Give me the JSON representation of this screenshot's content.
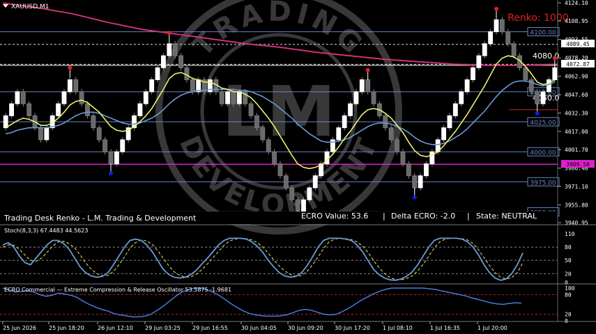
{
  "header": {
    "symbol_label": "XAUUSD,M1",
    "renko_label": "Renko: 1000",
    "status_line": {
      "title": "Trading Desk Renko - L.M. Trading & Development",
      "ecro_value": "ECRO Value: 53.6",
      "delta_ecro": "Delta ECRO: -2.0",
      "state": "State: NEUTRAL",
      "separator": "|"
    }
  },
  "watermark": {
    "top_text": "TRADING",
    "bottom_text": "DEVELOPMENT",
    "center_text": "LM"
  },
  "price_axis": {
    "ticks": [
      "4124.10",
      "4108.95",
      "4093.55",
      "4078.20",
      "4062.90",
      "4047.60",
      "4032.30",
      "4017.00",
      "4001.70",
      "3986.40",
      "3971.10",
      "3955.80",
      "3940.95"
    ],
    "tags": {
      "current_price": "4072.87",
      "line_4089": "4089.45",
      "line_3989": "3989.58"
    }
  },
  "levels": {
    "labels": [
      "4100.00",
      "4050.00",
      "4025.00",
      "4000.00",
      "3975.00",
      "3950.00"
    ],
    "inline_labels": [
      "4080.0",
      "4050.0"
    ]
  },
  "stoch": {
    "label": "Stoch(8,3,3) 67.4483 44.5623",
    "axis_ticks": [
      "110",
      "80",
      "50",
      "20",
      "0"
    ]
  },
  "ecro": {
    "label": "ECRO Commercial — Extreme Compression & Release Oscillator 53.5875 -1.9681",
    "axis_ticks": [
      "100",
      "80",
      "20",
      "0"
    ]
  },
  "time_axis": {
    "labels": [
      "25 Jun 2026",
      "25 Jun 18:20",
      "26 Jun 12:10",
      "29 Jun 03:25",
      "29 Jun 16:55",
      "30 Jun 04:05",
      "30 Jun 09:20",
      "30 Jun 17:20",
      "1 Jul 08:10",
      "1 Jul 16:35",
      "1 Jul 20:00"
    ]
  },
  "chart_data": {
    "type": "candlestick",
    "y_range": [
      3940.95,
      4124.1
    ],
    "bricks": [
      4030,
      4040,
      4050,
      4040,
      4030,
      4020,
      4010,
      4020,
      4030,
      4040,
      4050,
      4060,
      4050,
      4040,
      4030,
      4020,
      4010,
      4000,
      3990,
      4000,
      4010,
      4020,
      4030,
      4040,
      4050,
      4060,
      4070,
      4080,
      4090,
      4080,
      4070,
      4060,
      4050,
      4060,
      4050,
      4060,
      4050,
      4040,
      4050,
      4040,
      4050,
      4040,
      4030,
      4020,
      4010,
      4000,
      3990,
      3980,
      3970,
      3960,
      3950,
      3960,
      3970,
      3980,
      3990,
      4000,
      4010,
      4020,
      4030,
      4040,
      4050,
      4060,
      4050,
      4040,
      4030,
      4020,
      4010,
      4000,
      3990,
      3980,
      3970,
      3980,
      3990,
      4000,
      4010,
      4020,
      4030,
      4040,
      4050,
      4060,
      4070,
      4080,
      4090,
      4100,
      4110,
      4100,
      4090,
      4080,
      4070,
      4060,
      4050,
      4040,
      4050,
      4060,
      4070
    ],
    "ema_fast": [
      4020,
      4023,
      4026,
      4028,
      4027,
      4025,
      4022,
      4022,
      4024,
      4028,
      4033,
      4039,
      4042,
      4043,
      4041,
      4037,
      4033,
      4027,
      4021,
      4018,
      4017,
      4018,
      4021,
      4025,
      4030,
      4036,
      4044,
      4052,
      4061,
      4065,
      4066,
      4064,
      4061,
      4060,
      4058,
      4058,
      4056,
      4053,
      4052,
      4050,
      4050,
      4048,
      4045,
      4040,
      4034,
      4028,
      4021,
      4013,
      4005,
      3997,
      3990,
      3987,
      3986,
      3987,
      3989,
      3993,
      3998,
      4004,
      4011,
      4017,
      4024,
      4031,
      4035,
      4036,
      4035,
      4032,
      4028,
      4022,
      4016,
      4008,
      4001,
      3997,
      3996,
      3997,
      4000,
      4005,
      4011,
      4017,
      4024,
      4031,
      4039,
      4047,
      4055,
      4064,
      4073,
      4078,
      4080,
      4079,
      4076,
      4071,
      4065,
      4058,
      4056,
      4057,
      4060
    ],
    "ema_slow": [
      4015,
      4016,
      4018,
      4019,
      4020,
      4020,
      4020,
      4020,
      4021,
      4022,
      4024,
      4027,
      4030,
      4032,
      4033,
      4033,
      4032,
      4030,
      4028,
      4026,
      4024,
      4023,
      4023,
      4024,
      4026,
      4028,
      4031,
      4035,
      4040,
      4044,
      4047,
      4049,
      4050,
      4051,
      4051,
      4052,
      4052,
      4052,
      4052,
      4052,
      4051,
      4051,
      4050,
      4048,
      4046,
      4043,
      4040,
      4036,
      4032,
      4028,
      4023,
      4019,
      4015,
      4012,
      4009,
      4008,
      4008,
      4009,
      4010,
      4012,
      4015,
      4018,
      4021,
      4023,
      4024,
      4024,
      4023,
      4021,
      4019,
      4016,
      4012,
      4009,
      4007,
      4006,
      4006,
      4007,
      4009,
      4012,
      4015,
      4019,
      4024,
      4029,
      4034,
      4040,
      4046,
      4051,
      4055,
      4058,
      4059,
      4059,
      4058,
      4056,
      4055,
      4056,
      4058
    ],
    "ma_pink": [
      4124,
      4120,
      4115,
      4108,
      4102,
      4098,
      4094,
      4090,
      4087,
      4083,
      4080,
      4077,
      4075,
      4073,
      4072,
      4072,
      4073
    ],
    "swing_highs": [
      {
        "i": 11,
        "p": 4070
      },
      {
        "i": 28,
        "p": 4099
      },
      {
        "i": 62,
        "p": 4068
      },
      {
        "i": 84,
        "p": 4119
      },
      {
        "i": 94,
        "p": 4078
      }
    ],
    "swing_lows": [
      {
        "i": 18,
        "p": 3982
      },
      {
        "i": 50,
        "p": 3943
      },
      {
        "i": 70,
        "p": 3962
      },
      {
        "i": 91,
        "p": 4032
      }
    ],
    "levels": [
      4100,
      4050,
      4025,
      4000,
      3975,
      3950
    ],
    "stoch_main": [
      85,
      90,
      80,
      60,
      45,
      40,
      55,
      70,
      85,
      95,
      95,
      88,
      75,
      55,
      35,
      22,
      15,
      12,
      14,
      22,
      40,
      60,
      80,
      95,
      98,
      95,
      85,
      70,
      50,
      30,
      18,
      12,
      10,
      12,
      18,
      28,
      42,
      55,
      70,
      85,
      95,
      100,
      100,
      100,
      98,
      92,
      82,
      68,
      50,
      35,
      22,
      15,
      12,
      14,
      22,
      38,
      58,
      80,
      95,
      100,
      100,
      100,
      98,
      95,
      85,
      70,
      50,
      30,
      18,
      10,
      6,
      5,
      8,
      14,
      24,
      40,
      60,
      80,
      95,
      100,
      100,
      100,
      100,
      98,
      92,
      80,
      62,
      40,
      22,
      10,
      5,
      8,
      20,
      40,
      67
    ],
    "stoch_signal": [
      80,
      85,
      84,
      75,
      62,
      50,
      48,
      55,
      68,
      82,
      92,
      93,
      88,
      78,
      62,
      44,
      30,
      20,
      15,
      16,
      25,
      40,
      58,
      78,
      90,
      96,
      94,
      86,
      72,
      55,
      38,
      24,
      16,
      12,
      13,
      19,
      29,
      42,
      56,
      70,
      84,
      94,
      98,
      100,
      99,
      96,
      90,
      80,
      66,
      51,
      37,
      26,
      18,
      14,
      16,
      25,
      40,
      58,
      77,
      92,
      98,
      100,
      99,
      97,
      92,
      83,
      68,
      50,
      34,
      20,
      11,
      7,
      6,
      9,
      15,
      26,
      41,
      60,
      78,
      92,
      98,
      100,
      100,
      99,
      96,
      88,
      74,
      56,
      38,
      22,
      12,
      8,
      11,
      22,
      45
    ],
    "ecro_main": [
      100,
      95,
      88,
      90,
      92,
      88,
      80,
      75,
      78,
      85,
      82,
      78,
      72,
      60,
      50,
      42,
      35,
      30,
      22,
      18,
      15,
      12,
      12,
      14,
      20,
      32,
      45,
      60,
      75,
      88,
      95,
      100,
      100,
      95,
      88,
      78,
      65,
      52,
      40,
      30,
      22,
      18,
      15,
      14,
      14,
      15,
      18,
      25,
      32,
      35,
      32,
      26,
      20,
      18,
      20,
      28,
      38,
      50,
      62,
      72,
      82,
      90,
      96,
      100,
      100,
      100,
      100,
      100,
      100,
      98,
      96,
      92,
      88,
      84,
      80,
      76,
      70,
      65,
      60,
      55,
      52,
      50,
      53,
      55,
      54
    ]
  }
}
